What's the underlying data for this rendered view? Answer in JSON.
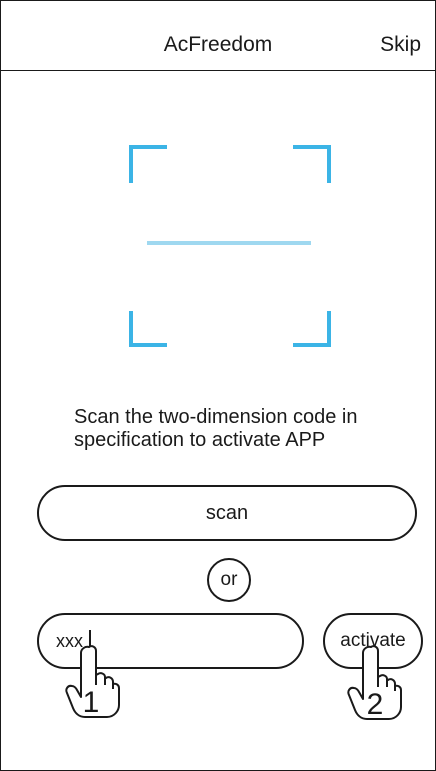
{
  "header": {
    "title": "AcFreedom",
    "skip_label": "Skip"
  },
  "scanner": {
    "bracket_color": "#3bb4e6",
    "scan_line_color": "#9fd8f0"
  },
  "instruction": {
    "text": "Scan the two-dimension code in specification to activate APP"
  },
  "scan_button": {
    "label": "scan"
  },
  "divider": {
    "label": "or"
  },
  "code_input": {
    "value": "xxx"
  },
  "activate_button": {
    "label": "activate"
  },
  "hints": {
    "step1": "1",
    "step2": "2"
  },
  "icons": {
    "scan_frame": "qr-scan-frame-icon",
    "pointer_hand": "pointing-hand-icon"
  }
}
